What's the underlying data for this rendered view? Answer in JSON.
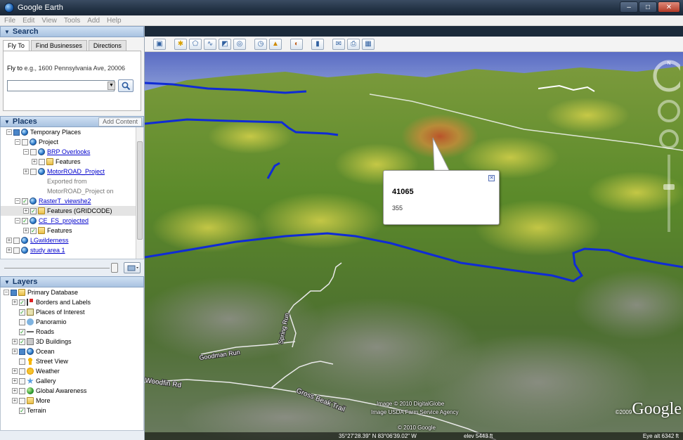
{
  "window": {
    "title": "Google Earth"
  },
  "menu": [
    "File",
    "Edit",
    "View",
    "Tools",
    "Add",
    "Help"
  ],
  "search": {
    "header": "Search",
    "tabs": [
      "Fly To",
      "Find Businesses",
      "Directions"
    ],
    "flyto_label": "Fly to",
    "flyto_example": "e.g., 1600 Pennsylvania Ave, 20006",
    "input_value": ""
  },
  "places": {
    "header": "Places",
    "add_button": "Add Content",
    "items": [
      "Temporary Places",
      "Project",
      "BRP Overlooks",
      "Features",
      "MotorROAD_Project",
      "Exported from",
      "MotorROAD_Project on",
      "RasterT_viewshe2",
      "Features (GRIDCODE)",
      "CE_FS_projected",
      "Features",
      "LGwilderness",
      "study area 1"
    ]
  },
  "layers": {
    "header": "Layers",
    "items": [
      "Primary Database",
      "Borders and Labels",
      "Places of Interest",
      "Panoramio",
      "Roads",
      "3D Buildings",
      "Ocean",
      "Street View",
      "Weather",
      "Gallery",
      "Global Awareness",
      "More",
      "Terrain"
    ]
  },
  "balloon": {
    "title": "41065",
    "value": "355"
  },
  "map_labels": {
    "road1": "Woodfin Rd",
    "road2": "Spring Run",
    "road3": "Gross Beak Trail",
    "road4": "Goodman Run"
  },
  "attribution": {
    "line1": "Image © 2010 DigitalGlobe",
    "line2": "Image USDA Farm Service Agency",
    "line3": "© 2010 Google",
    "logo": "Google",
    "logo_year": "©2009"
  },
  "status": {
    "coords": "35°27'28.39\" N    83°06'39.02\" W",
    "elev": "elev  5443 ft",
    "eye_alt": "Eye alt   6342 ft"
  },
  "colors": {
    "route": "#0f2bd6",
    "balloon_bg": "#ffffff",
    "titlebar": "#223244"
  }
}
